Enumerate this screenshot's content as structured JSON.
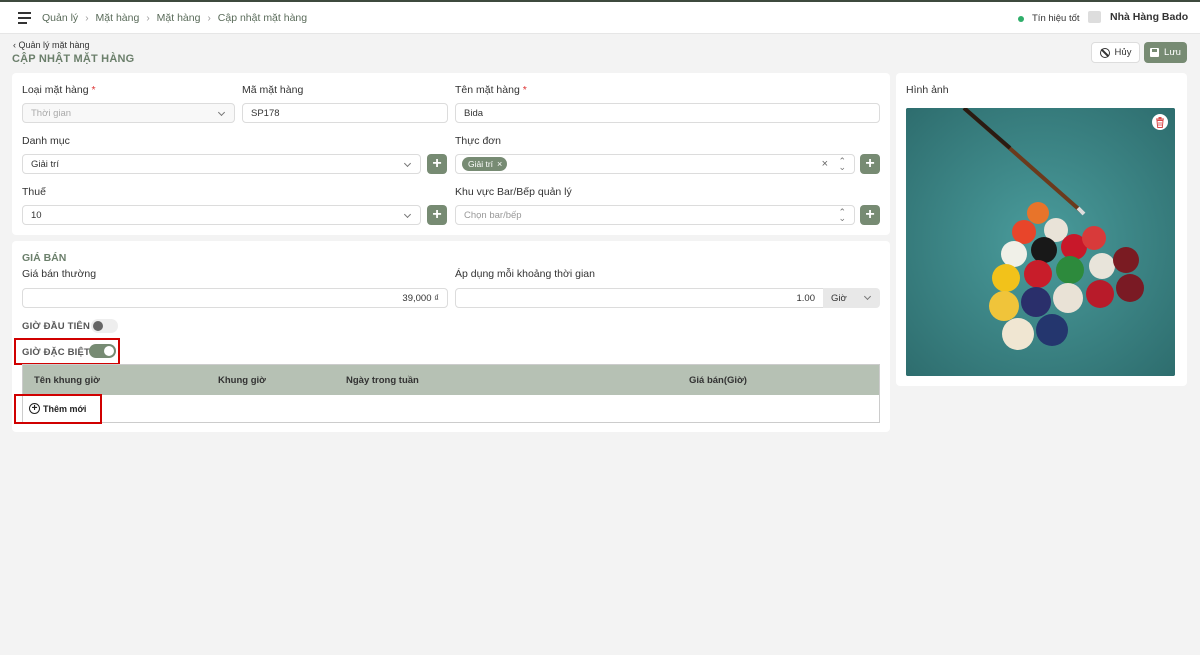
{
  "breadcrumb": [
    "Quản lý",
    "Mặt hàng",
    "Mặt hàng",
    "Cập nhật mặt hàng"
  ],
  "header": {
    "signal_label": "Tín hiệu tốt",
    "store_name": "Nhà Hàng Bado"
  },
  "page": {
    "back_label": "Quản lý mặt hàng",
    "title": "CẬP NHẬT MẶT HÀNG"
  },
  "actions": {
    "cancel_label": "Hủy",
    "save_label": "Lưu"
  },
  "form": {
    "item_type": {
      "label": "Loại mặt hàng",
      "value": "Thời gian"
    },
    "item_code": {
      "label": "Mã mặt hàng",
      "value": "SP178"
    },
    "item_name": {
      "label": "Tên mặt hàng",
      "value": "Bida"
    },
    "category": {
      "label": "Danh mục",
      "value": "Giải trí"
    },
    "menu": {
      "label": "Thực đơn",
      "tag": "Giải trí"
    },
    "tax": {
      "label": "Thuế",
      "value": "10"
    },
    "kitchen": {
      "label": "Khu vực Bar/Bếp quản lý",
      "placeholder": "Chọn bar/bếp"
    }
  },
  "pricing": {
    "section_title": "GIÁ BÁN",
    "regular_price": {
      "label": "Giá bán thường",
      "value": "39,000 ₫"
    },
    "time_apply": {
      "label": "Áp dụng mỗi khoảng thời gian",
      "value": "1.00",
      "unit": "Giờ"
    },
    "first_hour": {
      "label": "GIỜ ĐẦU TIÊN",
      "enabled": false
    },
    "special_hour": {
      "label": "GIỜ ĐẶC BIỆT",
      "enabled": true
    },
    "table_headers": [
      "Tên khung giờ",
      "Khung giờ",
      "Ngày trong tuần",
      "Giá bán(Giờ)"
    ],
    "add_new_label": "Thêm mới"
  },
  "image": {
    "title": "Hình ảnh"
  },
  "colors": {
    "accent": "#778b73",
    "table_header": "#b6c1b4",
    "highlight": "#d00000"
  }
}
